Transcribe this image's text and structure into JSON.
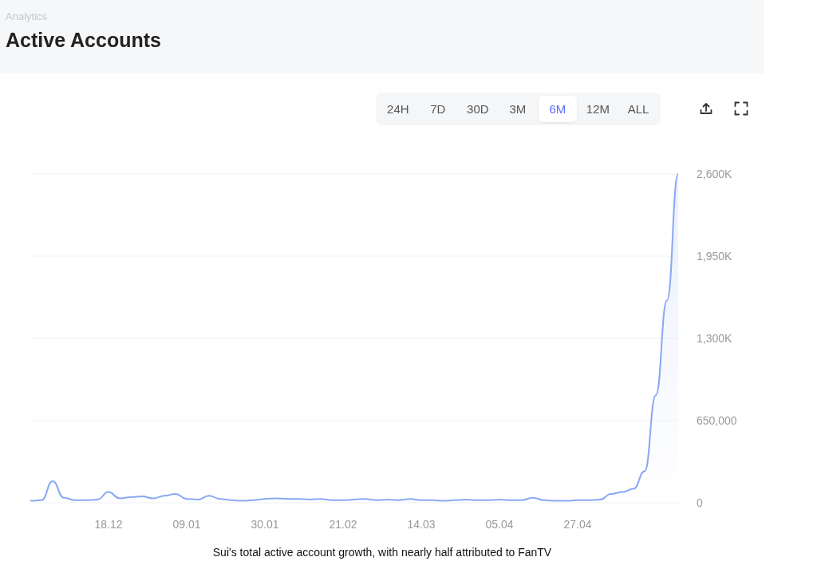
{
  "header": {
    "breadcrumb": "Analytics",
    "title": "Active Accounts"
  },
  "ranges": [
    {
      "label": "24H",
      "selected": false
    },
    {
      "label": "7D",
      "selected": false
    },
    {
      "label": "30D",
      "selected": false
    },
    {
      "label": "3M",
      "selected": false
    },
    {
      "label": "6M",
      "selected": true
    },
    {
      "label": "12M",
      "selected": false
    },
    {
      "label": "ALL",
      "selected": false
    }
  ],
  "chart": {
    "chart_data": {
      "type": "area",
      "categories": [
        null,
        null,
        null,
        null,
        null,
        null,
        null,
        "18.12",
        null,
        null,
        null,
        null,
        null,
        null,
        "09.01",
        null,
        null,
        null,
        null,
        null,
        null,
        "30.01",
        null,
        null,
        null,
        null,
        null,
        null,
        "21.02",
        null,
        null,
        null,
        null,
        null,
        null,
        "14.03",
        null,
        null,
        null,
        null,
        null,
        null,
        "05.04",
        null,
        null,
        null,
        null,
        null,
        null,
        "27.04",
        null,
        null,
        null,
        null,
        null,
        null,
        null,
        null,
        null
      ],
      "series": [
        {
          "color": "#8aa8f5",
          "values": [
            16000,
            20000,
            170000,
            40000,
            20000,
            20000,
            25000,
            85000,
            35000,
            45000,
            50000,
            35000,
            55000,
            70000,
            30000,
            25000,
            55000,
            30000,
            20000,
            15000,
            20000,
            30000,
            35000,
            30000,
            30000,
            25000,
            30000,
            20000,
            20000,
            25000,
            30000,
            20000,
            25000,
            20000,
            30000,
            20000,
            20000,
            15000,
            20000,
            25000,
            20000,
            20000,
            25000,
            20000,
            20000,
            40000,
            20000,
            15000,
            15000,
            20000,
            20000,
            25000,
            70000,
            85000,
            110000,
            250000,
            850000,
            1600000,
            2600000
          ]
        }
      ],
      "ylim": [
        0,
        2600000
      ],
      "grid": true,
      "yticks": [
        {
          "value": 0,
          "label": "0"
        },
        {
          "value": 650000,
          "label": "650,000"
        },
        {
          "value": 1300000,
          "label": "1,300K"
        },
        {
          "value": 1950000,
          "label": "1,950K"
        },
        {
          "value": 2600000,
          "label": "2,600K"
        }
      ]
    }
  },
  "caption": "Sui's total active account growth, with nearly half attributed to FanTV"
}
